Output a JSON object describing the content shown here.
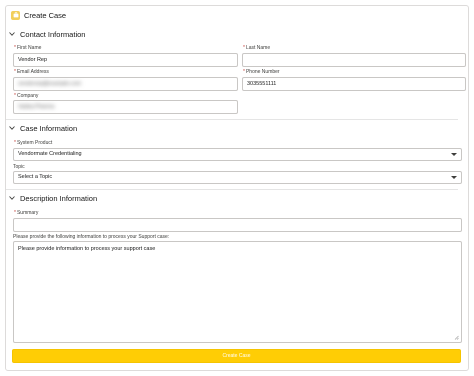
{
  "header": {
    "title": "Create Case",
    "icon": "case-icon"
  },
  "sections": {
    "contact": {
      "title": "Contact Information"
    },
    "case": {
      "title": "Case Information"
    },
    "description": {
      "title": "Description Information"
    }
  },
  "fields": {
    "first_name": {
      "label": "First Name",
      "required": "*",
      "value": "Vendor Rep"
    },
    "last_name": {
      "label": "Last Name",
      "required": "*",
      "value": ""
    },
    "email": {
      "label": "Email Address",
      "required": "*",
      "value": "vendorrep@example.com"
    },
    "phone": {
      "label": "Phone Number",
      "required": "*",
      "value": "3035551111"
    },
    "company": {
      "label": "Company",
      "required": "*",
      "value": "Vadeq Pharma"
    },
    "system_product": {
      "label": "System Product",
      "required": "*",
      "value": "Vendormate Credentialing"
    },
    "topic": {
      "label": "Topic",
      "value": "Select a Topic"
    },
    "summary": {
      "label": "Summary",
      "required": "*",
      "value": ""
    },
    "details": {
      "label": "Please provide the following information to process your Support case:",
      "value": "Please provide information to process your support case"
    }
  },
  "submit": {
    "label": "Create Case"
  },
  "colors": {
    "accent": "#ffcd05",
    "icon_bg": "#f2cf5b",
    "required": "#c23934"
  }
}
